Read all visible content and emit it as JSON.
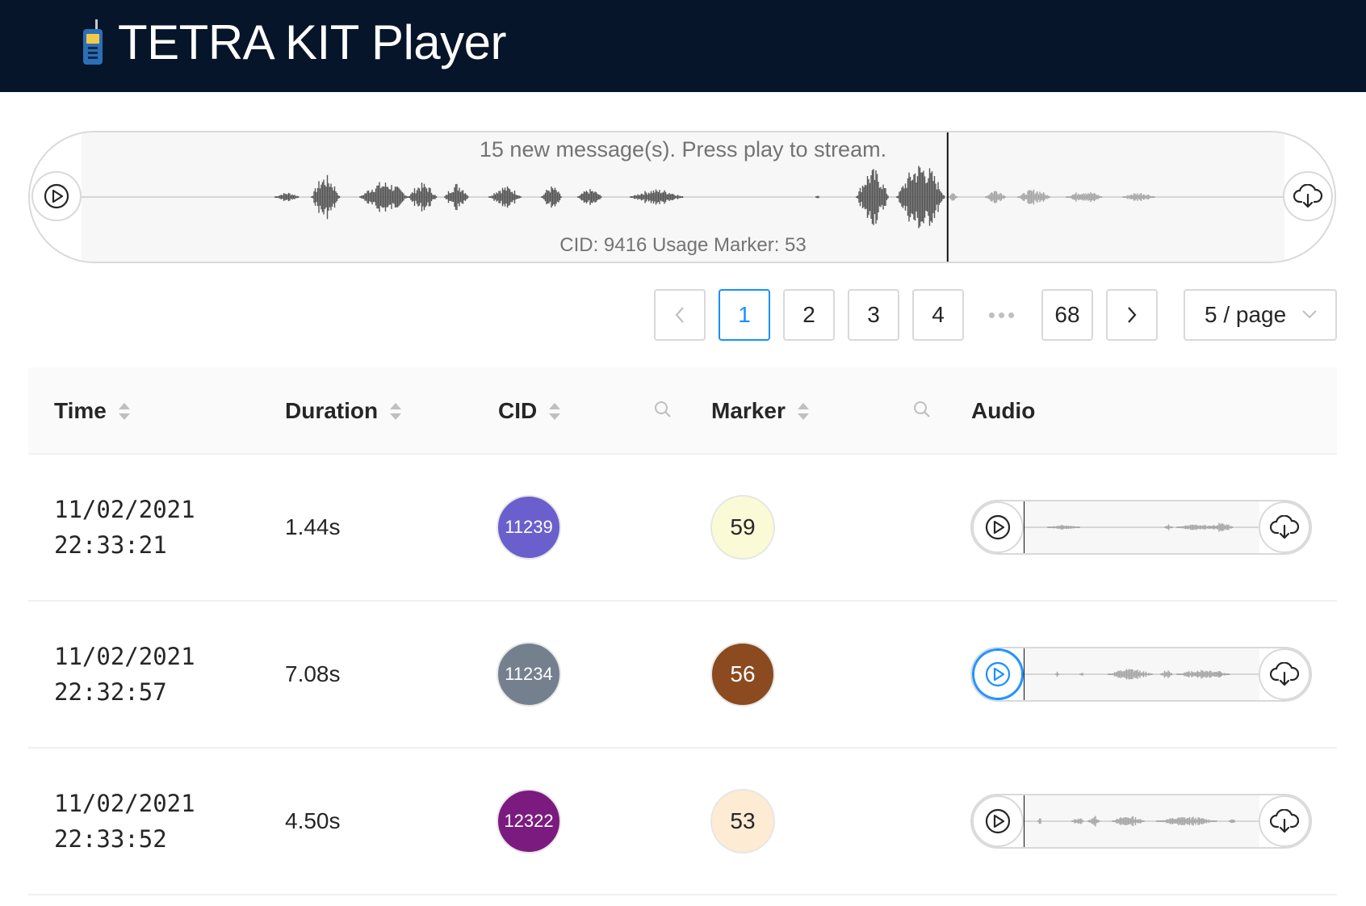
{
  "header": {
    "title": "TETRA KIT Player",
    "logo_icon": "walkie-talkie-icon"
  },
  "player": {
    "message": "15 new message(s). Press play to stream.",
    "cid_line": "CID: 9416 Usage Marker: 53",
    "played_fraction": 0.72
  },
  "pagination": {
    "prev_icon": "chevron-left-icon",
    "pages": [
      "1",
      "2",
      "3",
      "4"
    ],
    "ellipsis": "•••",
    "last_page": "68",
    "current": "1",
    "next_icon": "chevron-right-icon",
    "page_size": "5 / page"
  },
  "table": {
    "columns": {
      "time": "Time",
      "duration": "Duration",
      "cid": "CID",
      "marker": "Marker",
      "audio": "Audio"
    },
    "rows": [
      {
        "date": "11/02/2021",
        "time": "22:33:21",
        "duration": "1.44s",
        "cid": "11239",
        "cid_color": "#6a5fcd",
        "marker": "59",
        "marker_color": "#fbfad6"
      },
      {
        "date": "11/02/2021",
        "time": "22:32:57",
        "duration": "7.08s",
        "cid": "11234",
        "cid_color": "#75808f",
        "marker": "56",
        "marker_color": "#8b4a1f"
      },
      {
        "date": "11/02/2021",
        "time": "22:33:52",
        "duration": "4.50s",
        "cid": "12322",
        "cid_color": "#7b1b7f",
        "marker": "53",
        "marker_color": "#fdebd3"
      }
    ]
  },
  "colors": {
    "header_bg": "#061529",
    "accent": "#1890ff",
    "wave_played": "#555555",
    "wave_unplayed": "#a6a6a6"
  }
}
